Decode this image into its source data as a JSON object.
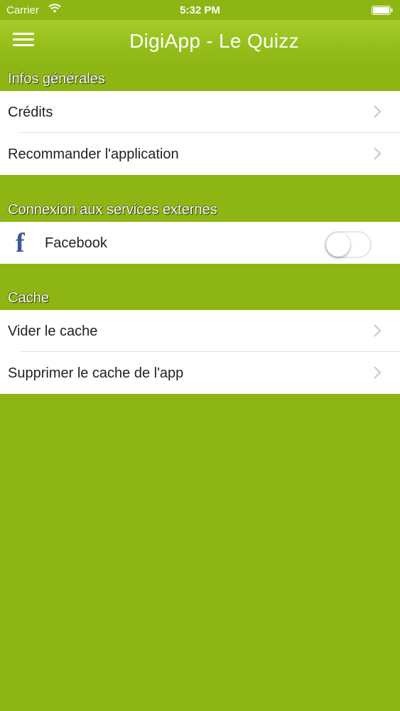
{
  "status_bar": {
    "carrier": "Carrier",
    "time": "5:32 PM"
  },
  "navbar": {
    "title": "DigiApp - Le Quizz",
    "menu_icon": "hamburger-menu-icon"
  },
  "sections": {
    "general": {
      "title": "Infos générales",
      "items": [
        {
          "label": "Crédits"
        },
        {
          "label": "Recommander l'application"
        }
      ]
    },
    "external": {
      "title": "Connexion aux services externes",
      "facebook": {
        "icon": "facebook-icon",
        "label": "Facebook",
        "enabled": false
      }
    },
    "cache": {
      "title": "Cache",
      "items": [
        {
          "label": "Vider le cache"
        },
        {
          "label": "Supprimer le cache de l'app"
        }
      ]
    }
  },
  "colors": {
    "background": "#8db513",
    "facebook": "#3b5998"
  }
}
